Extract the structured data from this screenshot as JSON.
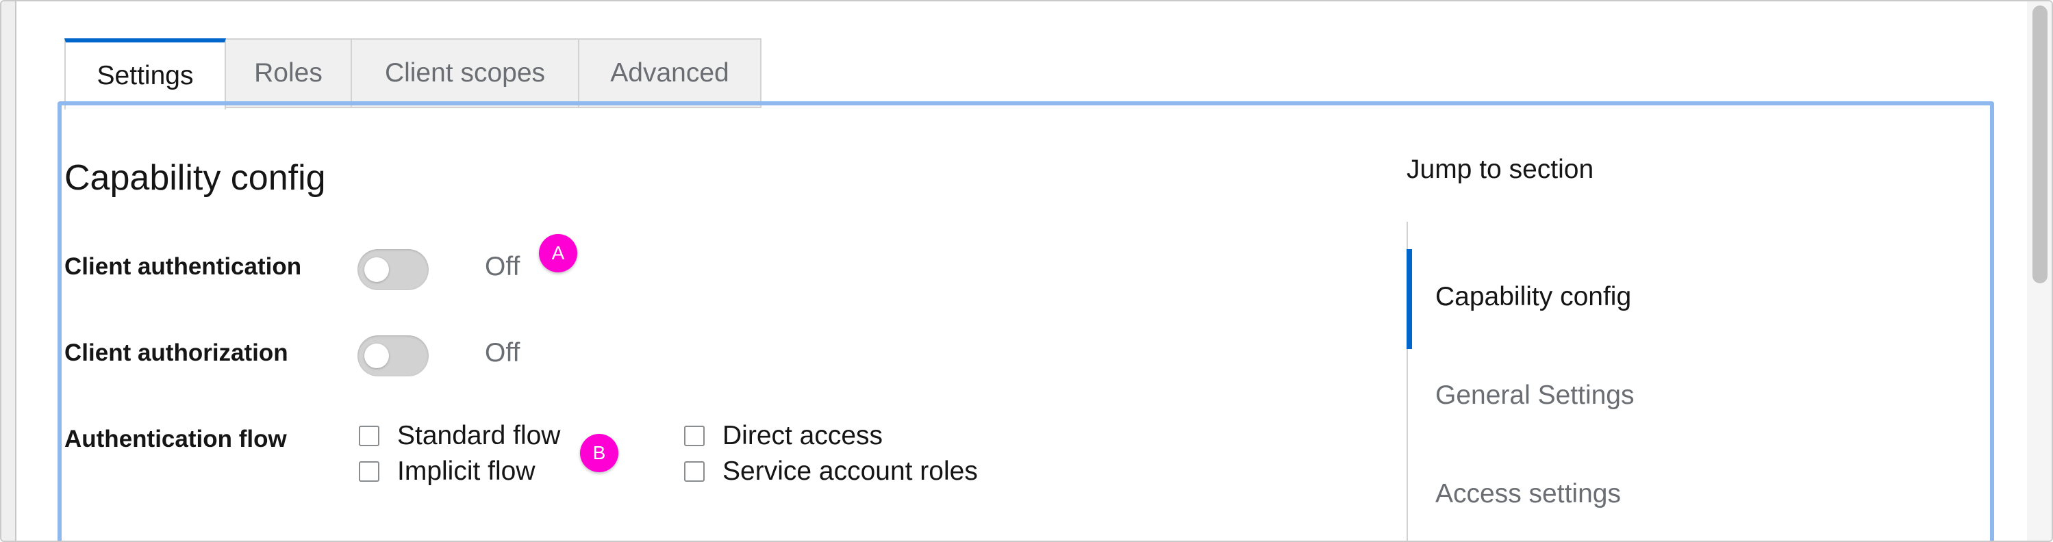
{
  "tabs": [
    {
      "label": "Settings",
      "active": true
    },
    {
      "label": "Roles",
      "active": false
    },
    {
      "label": "Client scopes",
      "active": false
    },
    {
      "label": "Advanced",
      "active": false
    }
  ],
  "capability": {
    "title": "Capability config",
    "client_authentication": {
      "label": "Client authentication",
      "state": "Off"
    },
    "client_authorization": {
      "label": "Client authorization",
      "state": "Off"
    },
    "authentication_flow": {
      "label": "Authentication flow",
      "options": [
        {
          "label": "Standard flow",
          "checked": false
        },
        {
          "label": "Implicit flow",
          "checked": false
        },
        {
          "label": "Direct access",
          "checked": false
        },
        {
          "label": "Service account roles",
          "checked": false
        }
      ]
    }
  },
  "annotations": {
    "a": "A",
    "b": "B",
    "color": "#ff00d4"
  },
  "jump": {
    "title": "Jump to section",
    "items": [
      {
        "label": "Capability config",
        "active": true
      },
      {
        "label": "General Settings",
        "active": false
      },
      {
        "label": "Access settings",
        "active": false
      }
    ]
  },
  "colors": {
    "accent": "#0066cc",
    "focus_outline": "#8fb8ef"
  },
  "icons": {
    "switch": "toggle-switch-icon",
    "checkbox": "checkbox-icon"
  }
}
